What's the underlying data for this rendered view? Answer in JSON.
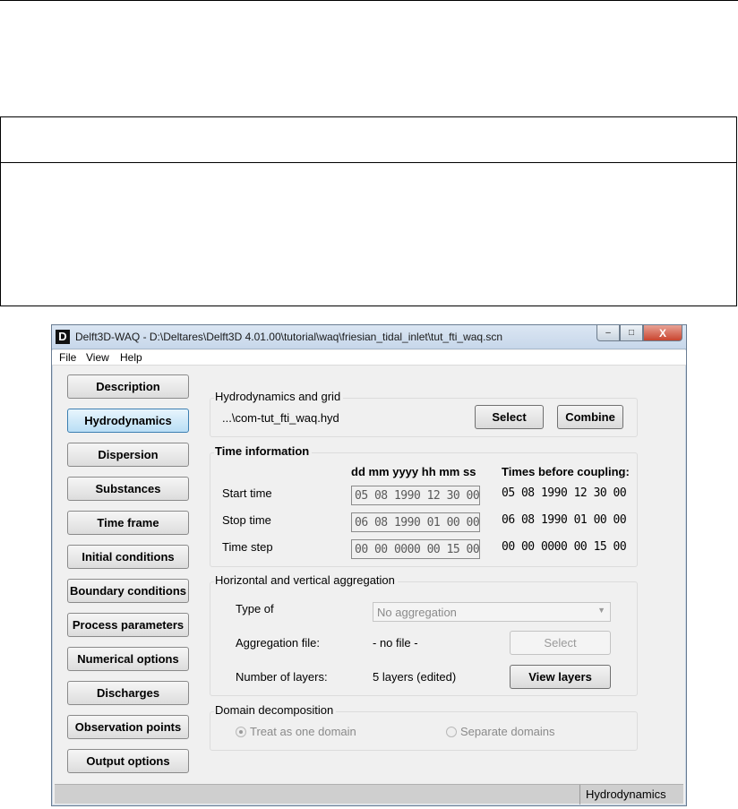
{
  "window": {
    "title": "Delft3D-WAQ - D:\\Deltares\\Delft3D 4.01.00\\tutorial\\waq\\friesian_tidal_inlet\\tut_fti_waq.scn",
    "app_icon": "D",
    "minimize_glyph": "‒",
    "maximize_glyph": "□",
    "close_glyph": "X"
  },
  "menu": [
    "File",
    "View",
    "Help"
  ],
  "nav": [
    "Description",
    "Hydrodynamics",
    "Dispersion",
    "Substances",
    "Time frame",
    "Initial conditions",
    "Boundary conditions",
    "Process parameters",
    "Numerical options",
    "Discharges",
    "Observation points",
    "Output options"
  ],
  "nav_active": "Hydrodynamics",
  "hydro": {
    "title": "Hydrodynamics and grid",
    "file": "...\\com-tut_fti_waq.hyd",
    "select_label": "Select",
    "combine_label": "Combine"
  },
  "time": {
    "title": "Time information",
    "format_header": "dd mm yyyy hh mm ss",
    "before_header": "Times before coupling:",
    "rows": [
      {
        "label": "Start time",
        "value": "05 08 1990 12 30 00",
        "before": "05 08 1990 12 30 00"
      },
      {
        "label": "Stop time",
        "value": "06 08 1990 01 00 00",
        "before": "06 08 1990 01 00 00"
      },
      {
        "label": "Time step",
        "value": "00 00 0000 00 15 00",
        "before": "00 00 0000 00 15 00"
      }
    ]
  },
  "aggregation": {
    "title": "Horizontal and vertical aggregation",
    "type_label": "Type of",
    "type_value": "No aggregation",
    "file_label": "Aggregation file:",
    "file_value": "- no file -",
    "select_label": "Select",
    "layers_label": "Number of layers:",
    "layers_value": "5 layers (edited)",
    "view_layers_label": "View layers"
  },
  "domain": {
    "title": "Domain decomposition",
    "option_one": "Treat as one domain",
    "option_separate": "Separate domains"
  },
  "status": {
    "panel": "Hydrodynamics"
  },
  "colors": {
    "active_button": "#b9def5",
    "window_bg": "#f0f0f0",
    "close_button": "#c9452f"
  }
}
